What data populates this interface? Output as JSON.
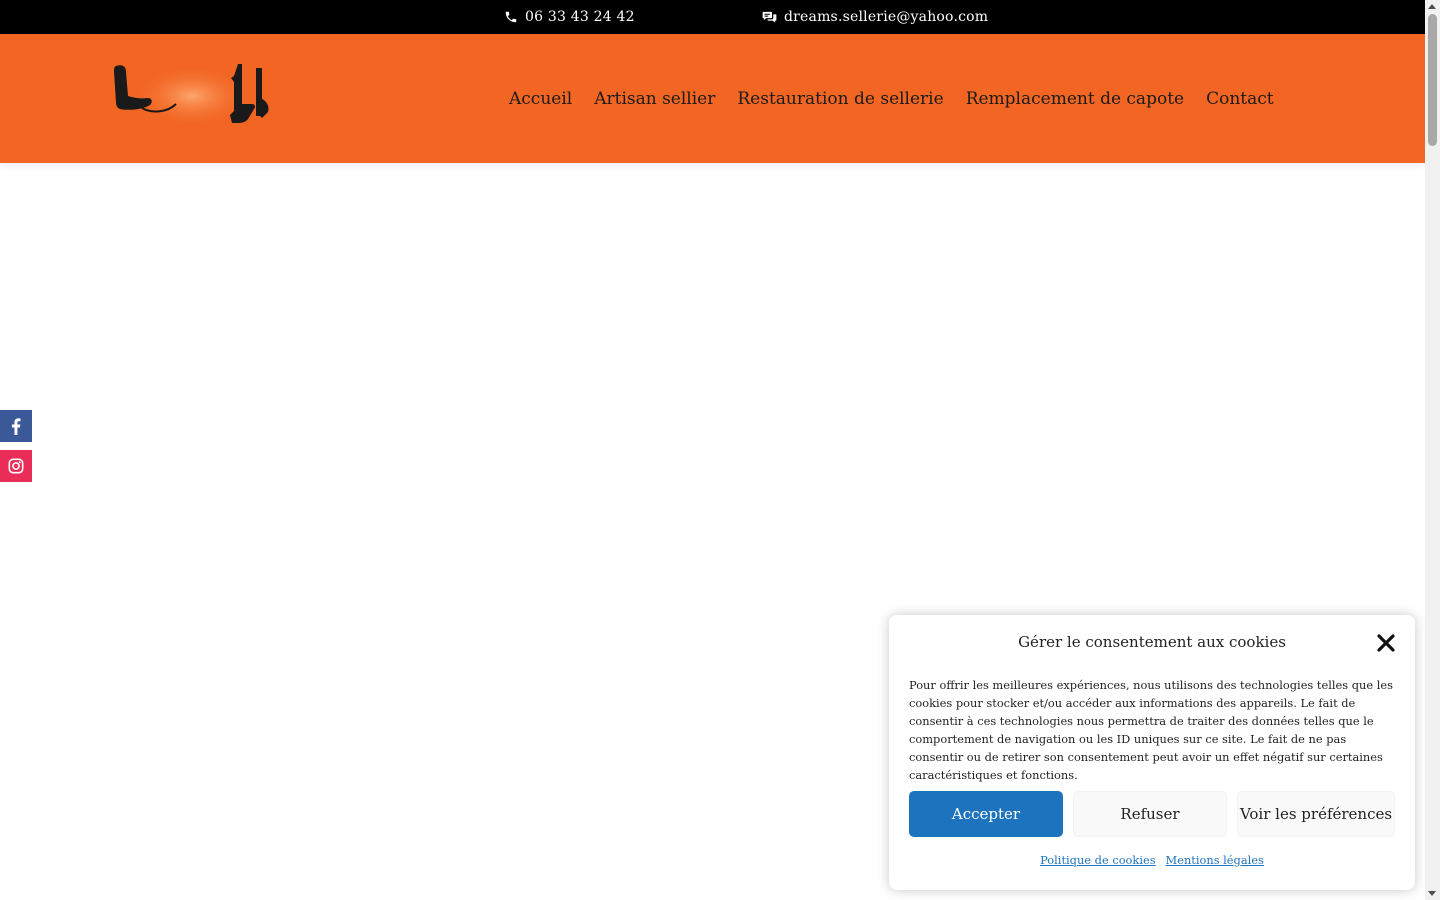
{
  "topbar": {
    "phone": "06 33 43 24 42",
    "email": "dreams.sellerie@yahoo.com",
    "phone_icon": "phone-icon",
    "email_icon": "chat-icon"
  },
  "header": {
    "logo_alt": "Dream's Sellerie",
    "logo_icon": "seat-logo",
    "nav": [
      "Accueil",
      "Artisan sellier",
      "Restauration de sellerie",
      "Remplacement de capote",
      "Contact"
    ]
  },
  "social": {
    "facebook_icon": "facebook-icon",
    "instagram_icon": "instagram-icon"
  },
  "cookie": {
    "title": "Gérer le consentement aux cookies",
    "message": "Pour offrir les meilleures expériences, nous utilisons des technologies telles que les cookies pour stocker et/ou accéder aux informations des appareils. Le fait de consentir à ces technologies nous permettra de traiter des données telles que le comportement de navigation ou les ID uniques sur ce site. Le fait de ne pas consentir ou de retirer son consentement peut avoir un effet négatif sur certaines caractéristiques et fonctions.",
    "accept": "Accepter",
    "refuse": "Refuser",
    "preferences": "Voir les préférences",
    "policy_link": "Politique de cookies",
    "legal_link": "Mentions légales"
  },
  "colors": {
    "topbar": "#000000",
    "header": "#f26522",
    "accent": "#1e73be",
    "facebook": "#3b5998",
    "instagram": "#ea2c59"
  }
}
